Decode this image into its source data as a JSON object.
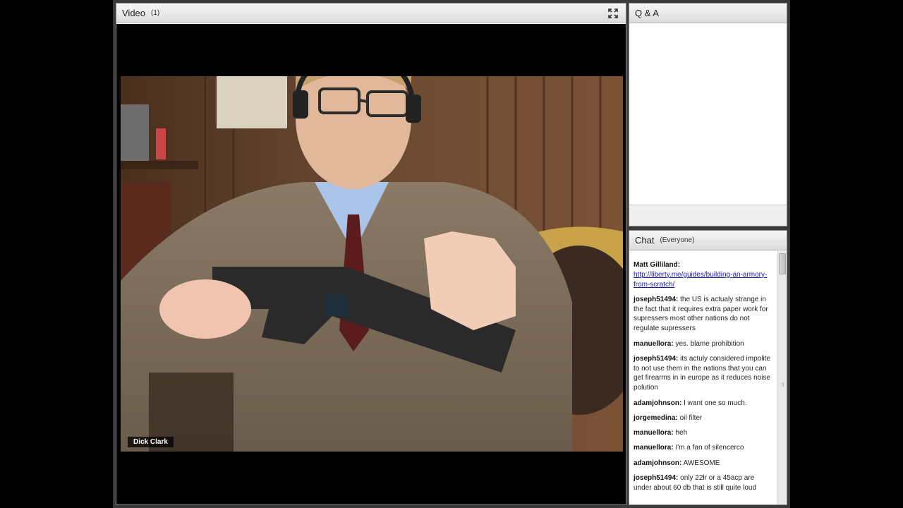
{
  "video_pod": {
    "title": "Video",
    "count": "(1)",
    "presenter_name": "Dick Clark"
  },
  "qa_pod": {
    "title": "Q & A"
  },
  "chat_pod": {
    "title": "Chat",
    "audience": "(Everyone)",
    "messages": [
      {
        "sender": "Matt Gilliland:",
        "text": "",
        "link": "http://liberty.me/guides/building-an-armory-from-scratch/"
      },
      {
        "sender": "joseph51494:",
        "text": " the US is actualy strange in the fact that it requires extra paper work for supressers  most other nations do not regulate supressers"
      },
      {
        "sender": "manuellora:",
        "text": " yes. blame prohibition"
      },
      {
        "sender": "joseph51494:",
        "text": " its actuly considered impolite to not use them in the nations that you can get firearms in in europe as it reduces noise polution"
      },
      {
        "sender": "adamjohnson:",
        "text": " I want one so much."
      },
      {
        "sender": "jorgemedina:",
        "text": " oil filter"
      },
      {
        "sender": "manuellora:",
        "text": " heh"
      },
      {
        "sender": "manuellora:",
        "text": " I'm a fan of silencerco"
      },
      {
        "sender": "adamjohnson:",
        "text": " AWESOME"
      },
      {
        "sender": "joseph51494:",
        "text": " only 22lr or a 45acp are under about 60 db that is still quite loud"
      }
    ]
  },
  "colors": {
    "app_bg": "#3a3a3a",
    "link": "#1a1aa8"
  },
  "icons": {
    "fullscreen": "fullscreen-icon"
  }
}
